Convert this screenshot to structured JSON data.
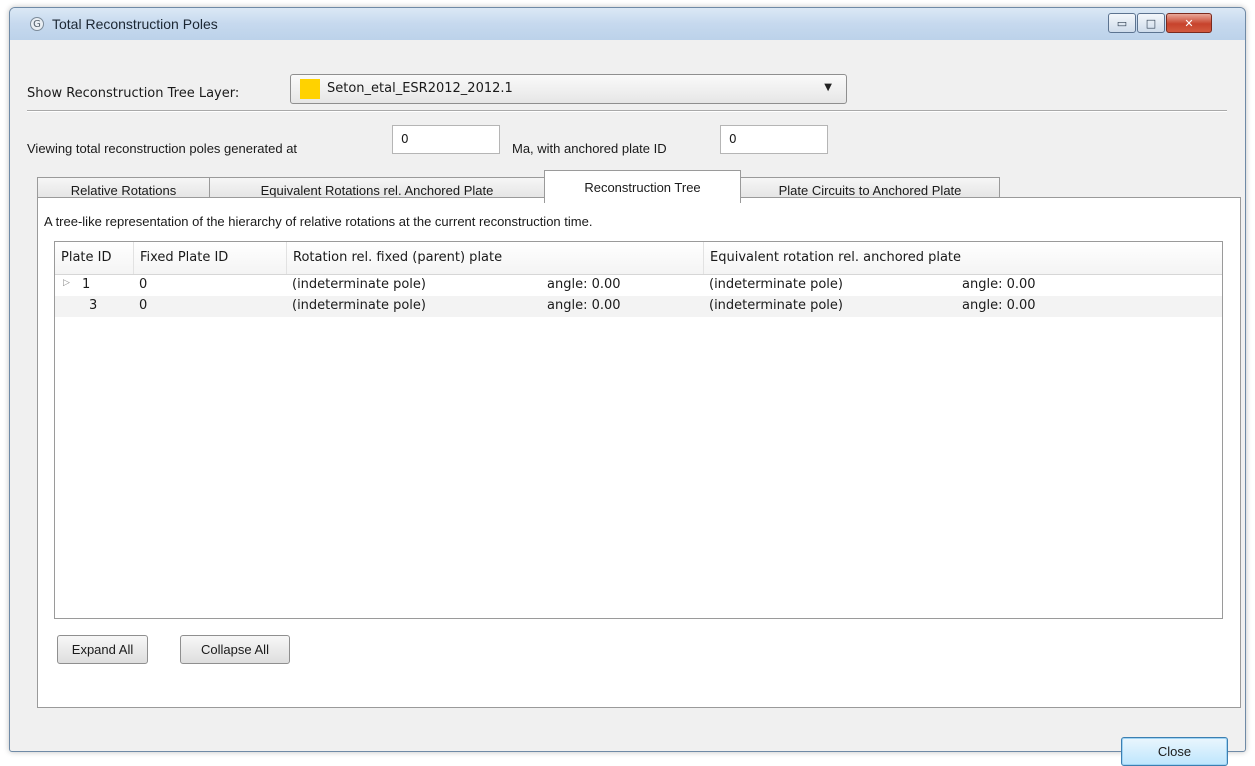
{
  "window": {
    "title": "Total Reconstruction Poles",
    "app_icon_glyph": "G",
    "controls": {
      "minimize": "▭",
      "maximize": "□",
      "close": "✕"
    }
  },
  "layer": {
    "label": "Show Reconstruction Tree Layer:",
    "selected": "Seton_etal_ESR2012_2012.1",
    "swatch_color": "#ffd200"
  },
  "viewing": {
    "prefix": "Viewing total reconstruction poles generated at",
    "time_value": "0",
    "middle": "Ma, with anchored plate ID",
    "plate_value": "0"
  },
  "tabs": [
    {
      "label": "Relative Rotations"
    },
    {
      "label": "Equivalent Rotations rel. Anchored Plate"
    },
    {
      "label": "Reconstruction Tree"
    },
    {
      "label": "Plate Circuits to Anchored Plate"
    }
  ],
  "active_tab": "Reconstruction Tree",
  "panel": {
    "description": "A tree-like representation of the hierarchy of relative rotations at the current reconstruction time."
  },
  "tree": {
    "columns": [
      "Plate ID",
      "Fixed Plate ID",
      "Rotation rel. fixed (parent) plate",
      "Equivalent rotation rel. anchored plate"
    ],
    "rows": [
      {
        "expander": "▷",
        "plate_id": "1",
        "fixed_plate_id": "0",
        "rel_pole": "(indeterminate pole)",
        "rel_angle": "angle: 0.00",
        "equiv_pole": "(indeterminate pole)",
        "equiv_angle": "angle: 0.00"
      },
      {
        "expander": "",
        "plate_id": "3",
        "fixed_plate_id": "0",
        "rel_pole": "(indeterminate pole)",
        "rel_angle": "angle: 0.00",
        "equiv_pole": "(indeterminate pole)",
        "equiv_angle": "angle: 0.00"
      }
    ]
  },
  "buttons": {
    "expand_all": "Expand All",
    "collapse_all": "Collapse All",
    "close": "Close"
  }
}
